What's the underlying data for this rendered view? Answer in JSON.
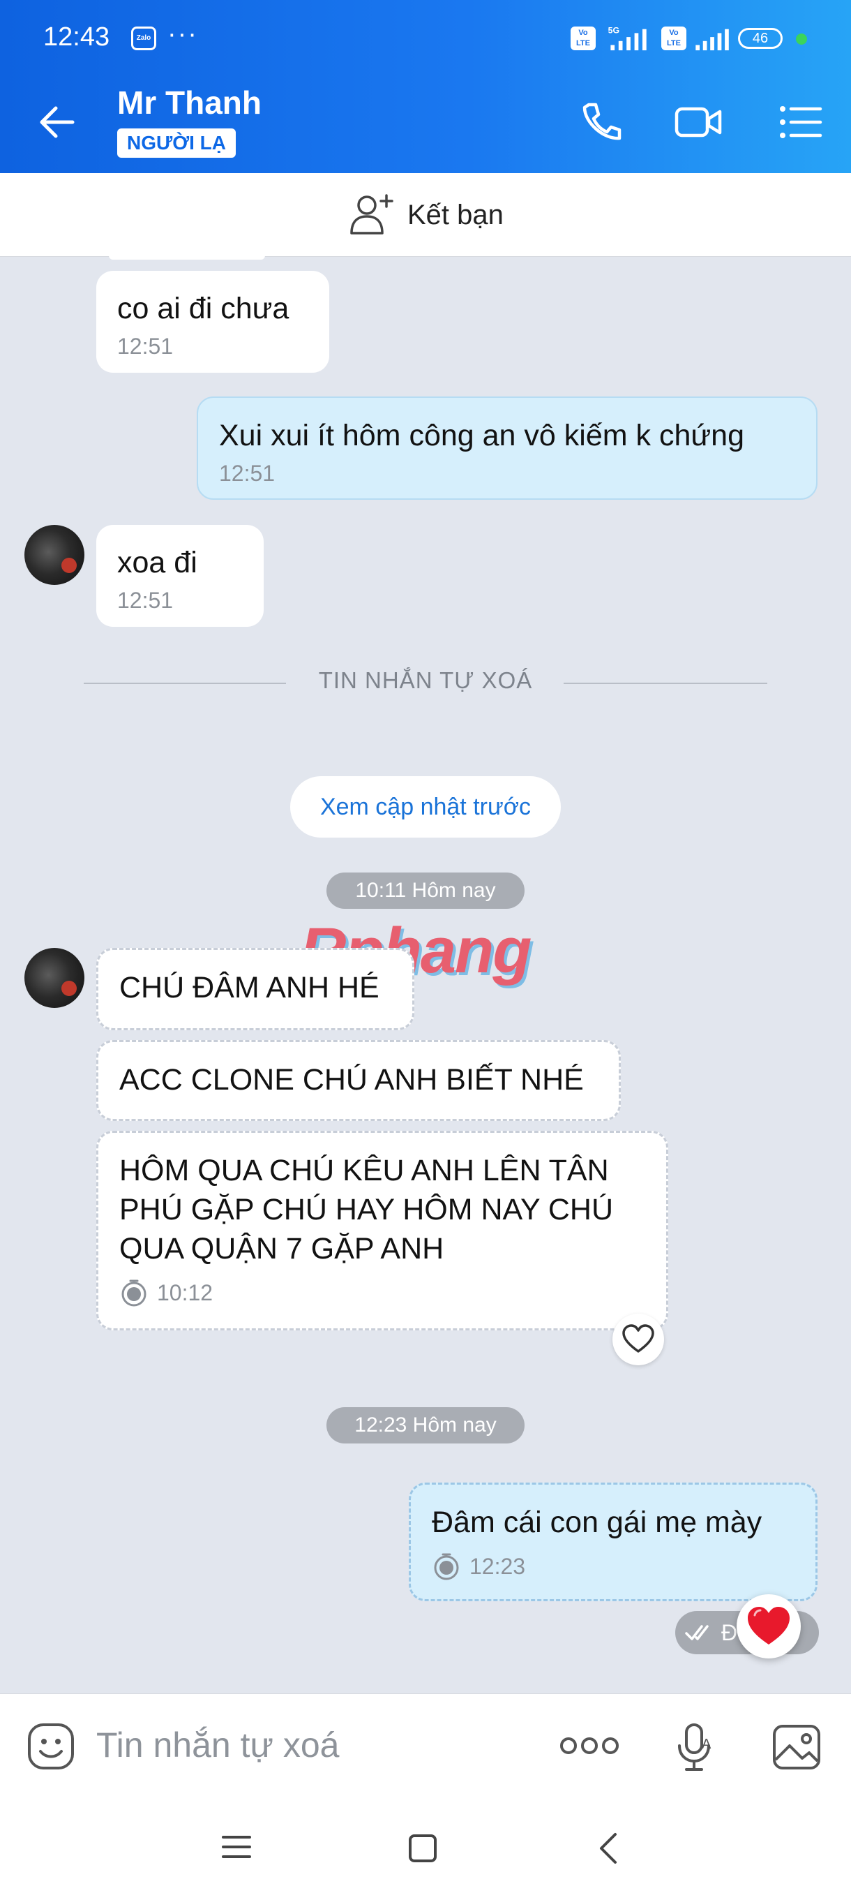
{
  "status_bar": {
    "time": "12:43",
    "app_badge": "Zalo",
    "more": "···",
    "network": "5G",
    "volte": "Vo LTE",
    "battery": "46"
  },
  "header": {
    "contact_name": "Mr Thanh",
    "badge": "NGƯỜI LẠ",
    "icons": [
      "back-arrow-icon",
      "phone-icon",
      "video-icon",
      "menu-list-icon"
    ]
  },
  "friend_bar": {
    "label": "Kết bạn"
  },
  "messages": [
    {
      "side": "in",
      "text": "co ai đi chưa",
      "time": "12:51"
    },
    {
      "side": "out",
      "text": "Xui xui ít hôm công an vô kiếm k chứng",
      "time": "12:51"
    },
    {
      "side": "in",
      "text": "xoa đi",
      "time": "12:51"
    },
    {
      "side": "in",
      "text": "CHÚ ĐÂM ANH HÉ",
      "time": ""
    },
    {
      "side": "in",
      "text": "ACC CLONE CHÚ ANH BIẾT NHÉ",
      "time": ""
    },
    {
      "side": "in",
      "text": "HÔM QUA CHÚ KÊU ANH LÊN TÂN PHÚ GẶP CHÚ HAY HÔM NAY CHÚ QUA QUẬN 7 GẶP ANH",
      "time": "10:12"
    },
    {
      "side": "out",
      "text": "Đâm cái con gái mẹ mày",
      "time": "12:23"
    }
  ],
  "divider_label": "TIN NHẮN TỰ XOÁ",
  "load_previous": "Xem cập nhật trước",
  "stamps": [
    "10:11 Hôm nay",
    "12:23 Hôm nay"
  ],
  "watermark": "Rphang",
  "delivery_status": "Đ",
  "input": {
    "placeholder": "Tin nhắn tự xoá"
  },
  "colors": {
    "header_start": "#0e62e0",
    "header_end": "#27a4f6",
    "chat_bg": "#e2e6ee",
    "out_bubble": "#d6effc",
    "accent": "#0d68e6"
  }
}
